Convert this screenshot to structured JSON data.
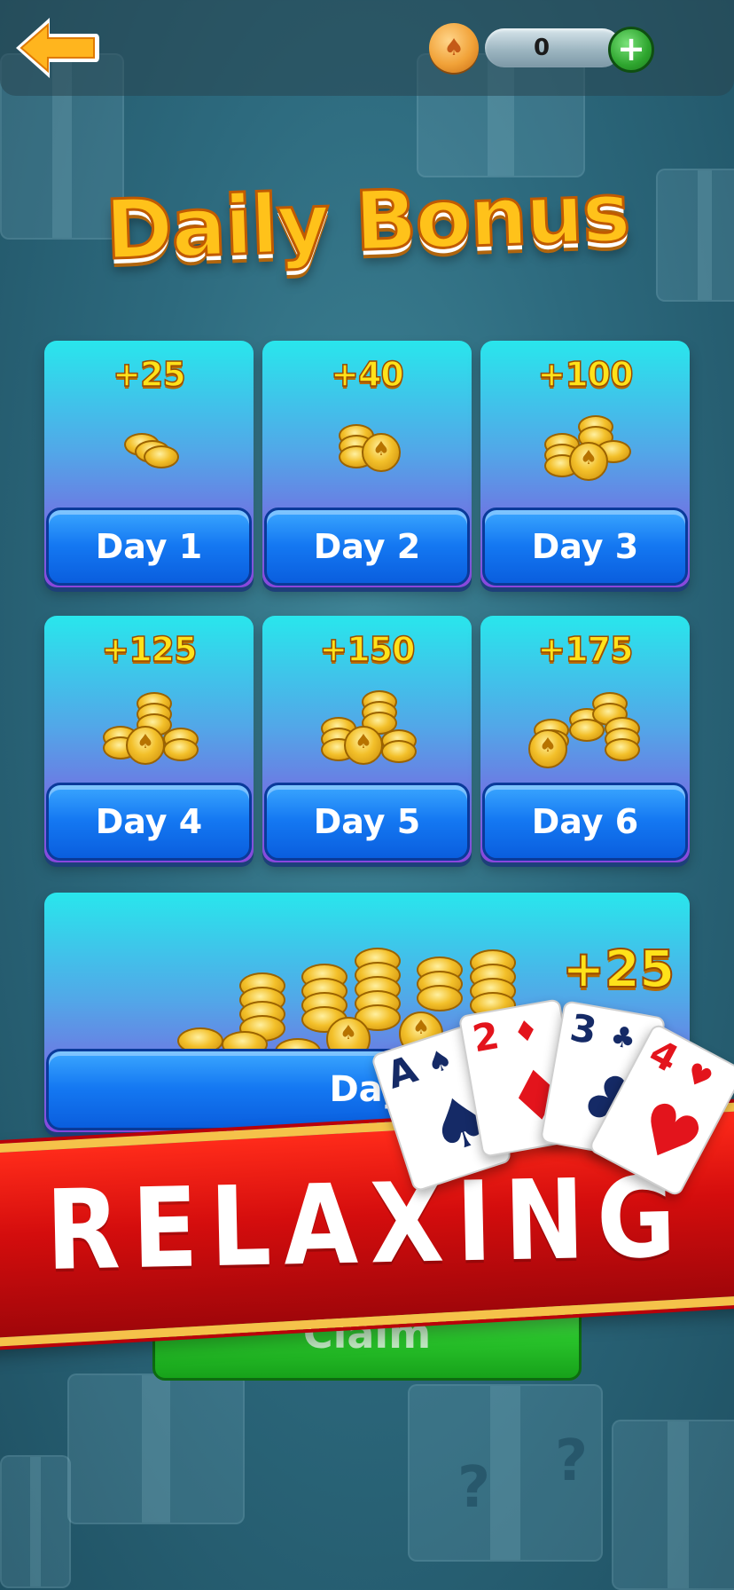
{
  "screen": {
    "title": "Daily Bonus",
    "balance": "0",
    "icons": {
      "back": "back-arrow-icon",
      "coin": "spade-coin-icon",
      "add": "plus-icon"
    }
  },
  "days": [
    {
      "label": "Day 1",
      "amount": "+25"
    },
    {
      "label": "Day 2",
      "amount": "+40"
    },
    {
      "label": "Day 3",
      "amount": "+100"
    },
    {
      "label": "Day 4",
      "amount": "+125"
    },
    {
      "label": "Day 5",
      "amount": "+150"
    },
    {
      "label": "Day 6",
      "amount": "+175"
    }
  ],
  "day7": {
    "label": "Day",
    "amount": "+25"
  },
  "claim": {
    "label": "Claim"
  },
  "banner": {
    "text": "RELAXING"
  },
  "cards": [
    {
      "rank": "A",
      "suit": "♠",
      "color": "#152a66"
    },
    {
      "rank": "2",
      "suit": "♦",
      "color": "#e3141c"
    },
    {
      "rank": "3",
      "suit": "♣",
      "color": "#152a66"
    },
    {
      "rank": "4",
      "suit": "♥",
      "color": "#e3141c"
    }
  ],
  "colors": {
    "title": "#ffc21a",
    "card_top": "#29e6ec",
    "card_bottom": "#8a46dd",
    "day_button": "#1478f2",
    "claim_button": "#29c42b",
    "banner": "#d40d0d",
    "amount": "#ffe21a"
  }
}
